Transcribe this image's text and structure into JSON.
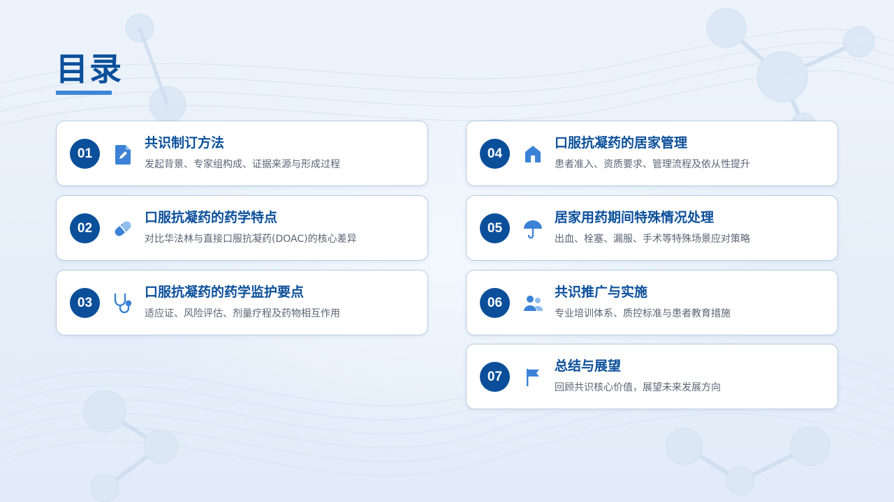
{
  "header": {
    "title": "目录"
  },
  "items": [
    {
      "num": "01",
      "icon": "edit-icon",
      "title": "共识制订方法",
      "desc": "发起背景、专家组构成、证据来源与形成过程"
    },
    {
      "num": "02",
      "icon": "pill-icon",
      "title": "口服抗凝药的药学特点",
      "desc": "对比华法林与直接口服抗凝药(DOAC)的核心差异"
    },
    {
      "num": "03",
      "icon": "stethoscope-icon",
      "title": "口服抗凝药的药学监护要点",
      "desc": "适应证、风险评估、剂量疗程及药物相互作用"
    },
    {
      "num": "04",
      "icon": "home-icon",
      "title": "口服抗凝药的居家管理",
      "desc": "患者准入、资质要求、管理流程及依从性提升"
    },
    {
      "num": "05",
      "icon": "umbrella-icon",
      "title": "居家用药期间特殊情况处理",
      "desc": "出血、栓塞、漏服、手术等特殊场景应对策略"
    },
    {
      "num": "06",
      "icon": "users-icon",
      "title": "共识推广与实施",
      "desc": "专业培训体系、质控标准与患者教育措施"
    },
    {
      "num": "07",
      "icon": "flag-icon",
      "title": "总结与展望",
      "desc": "回顾共识核心价值，展望未来发展方向"
    }
  ],
  "colors": {
    "primary": "#0b4f9a",
    "accent": "#3d85d8",
    "icon": "#3b82d6"
  }
}
